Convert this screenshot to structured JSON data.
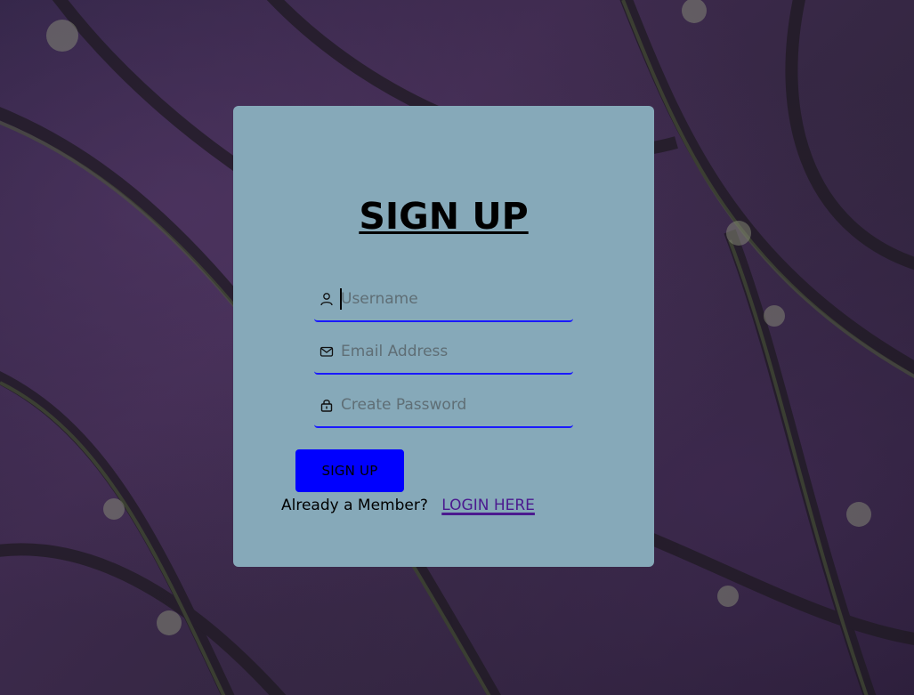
{
  "form": {
    "title": "SIGN UP",
    "fields": [
      {
        "placeholder": "Username",
        "icon": "user-icon",
        "value": ""
      },
      {
        "placeholder": "Email Address",
        "icon": "mail-icon",
        "value": ""
      },
      {
        "placeholder": "Create Password",
        "icon": "lock-icon",
        "value": ""
      }
    ],
    "submit_label": "SIGN UP",
    "footer_text": "Already a Member?",
    "login_link": "LOGIN HERE"
  },
  "colors": {
    "card": "#86a9b9",
    "button": "#0000ff",
    "field_underline": "#1a1aff",
    "link": "#4b1a8f",
    "background": "#3d2a4d"
  }
}
